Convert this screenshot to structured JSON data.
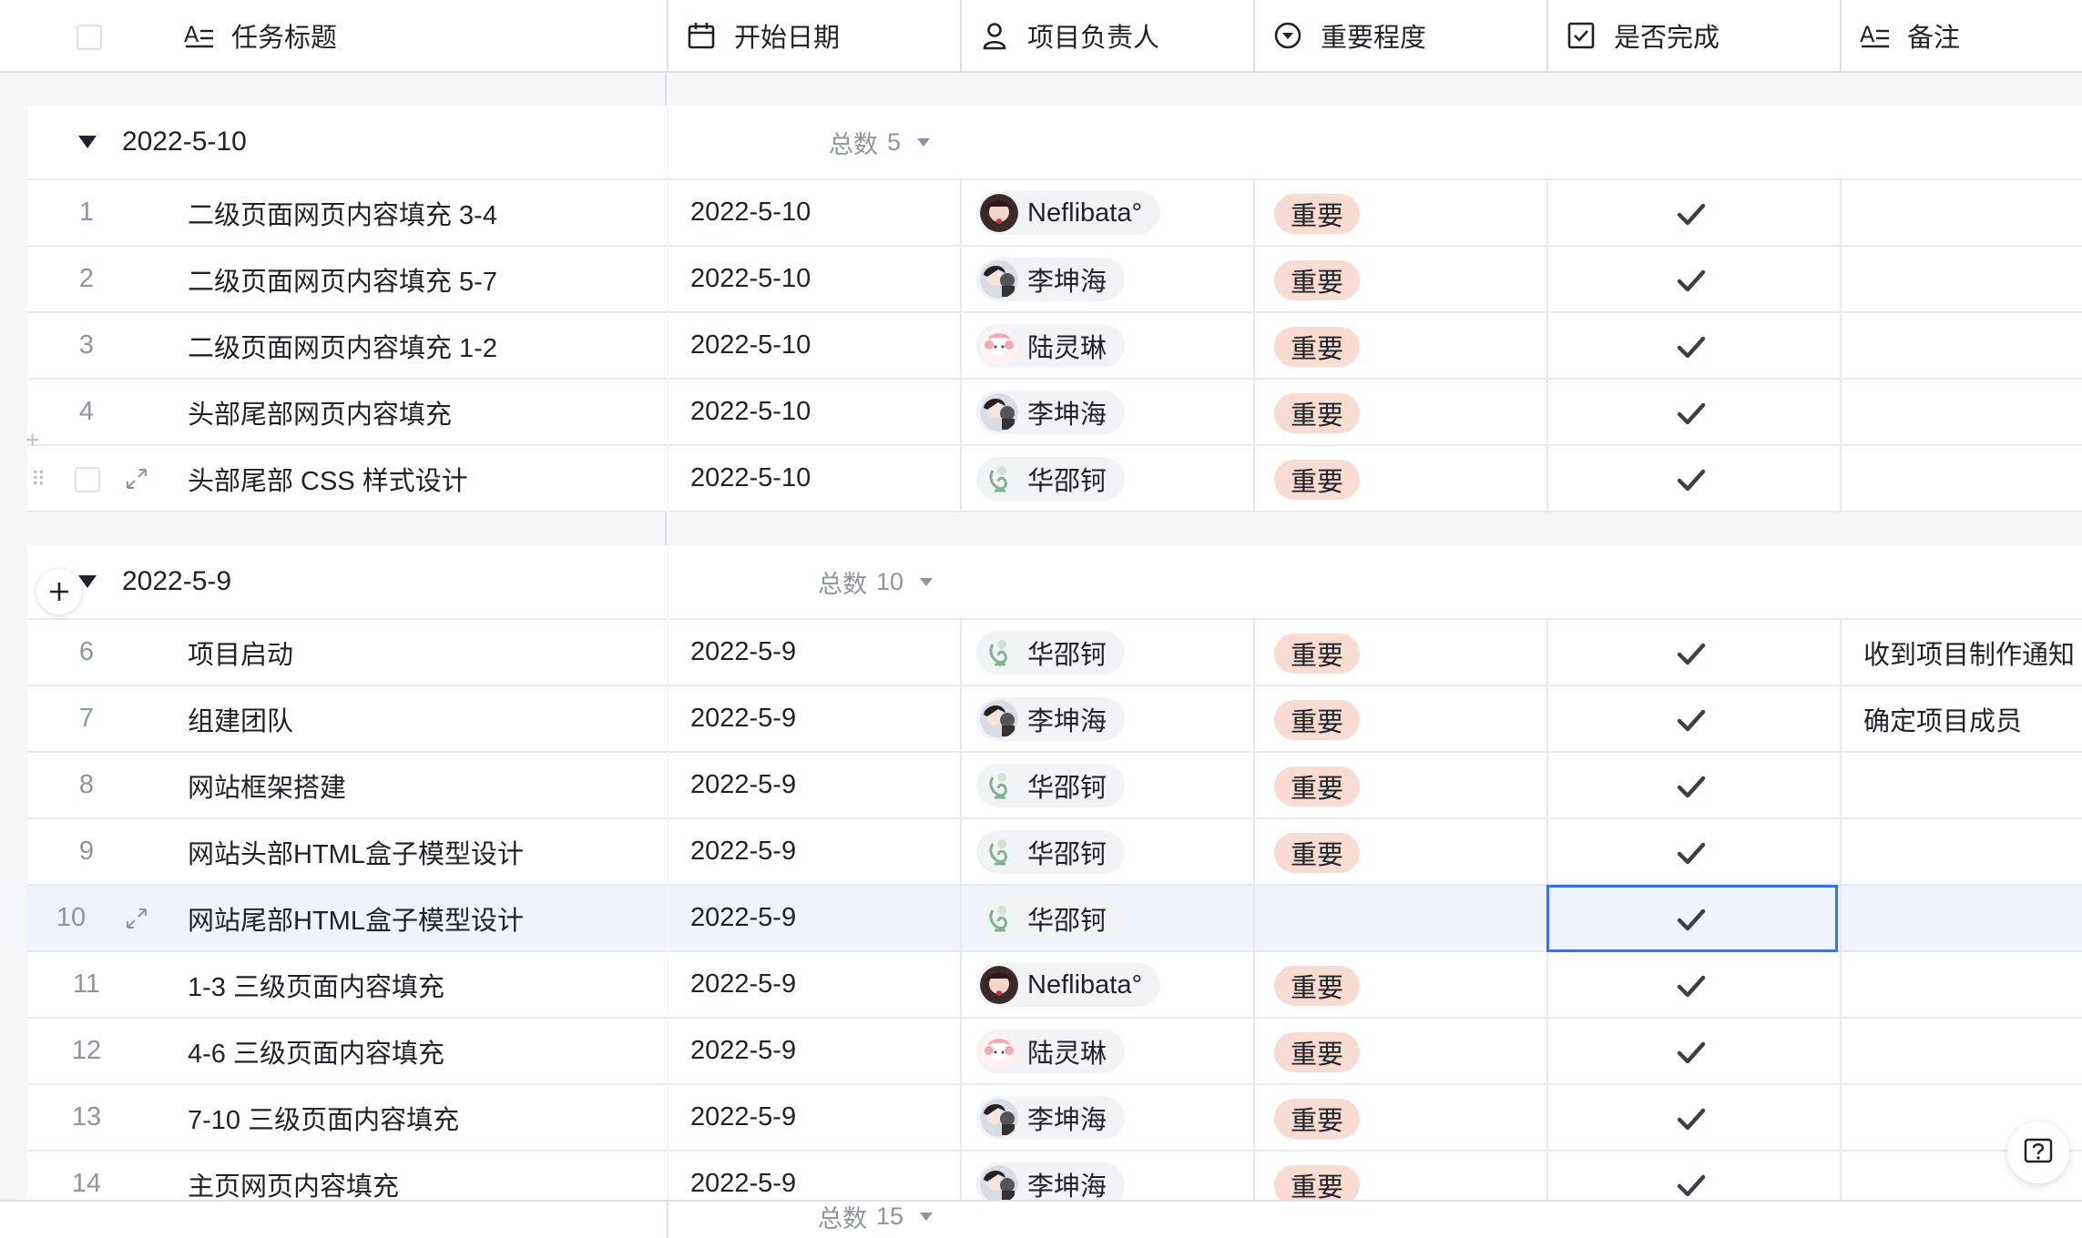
{
  "columns": [
    {
      "label": "任务标题",
      "icon": "text-icon"
    },
    {
      "label": "开始日期",
      "icon": "calendar-icon"
    },
    {
      "label": "项目负责人",
      "icon": "person-icon"
    },
    {
      "label": "重要程度",
      "icon": "single-select-icon"
    },
    {
      "label": "是否完成",
      "icon": "checkbox-icon"
    },
    {
      "label": "备注",
      "icon": "text-icon"
    }
  ],
  "groups": [
    {
      "label": "2022-5-10",
      "count_text": "总数",
      "count": "5",
      "rows": [
        {
          "num": "1",
          "title": "二级页面网页内容填充 3-4",
          "date": "2022-5-10",
          "owner": "Neflibata°",
          "avatar": "dark",
          "tag": "重要",
          "done": true,
          "note": ""
        },
        {
          "num": "2",
          "title": "二级页面网页内容填充 5-7",
          "date": "2022-5-10",
          "owner": "李坤海",
          "avatar": "boy",
          "tag": "重要",
          "done": true,
          "note": ""
        },
        {
          "num": "3",
          "title": "二级页面网页内容填充 1-2",
          "date": "2022-5-10",
          "owner": "陆灵琳",
          "avatar": "pink",
          "tag": "重要",
          "done": true,
          "note": ""
        },
        {
          "num": "4",
          "title": "头部尾部网页内容填充",
          "date": "2022-5-10",
          "owner": "李坤海",
          "avatar": "boy",
          "tag": "重要",
          "done": true,
          "note": ""
        },
        {
          "num": "",
          "title": "头部尾部 CSS 样式设计",
          "date": "2022-5-10",
          "owner": "华邵钶",
          "avatar": "green",
          "tag": "重要",
          "done": true,
          "note": ""
        }
      ]
    },
    {
      "label": "2022-5-9",
      "count_text": "总数",
      "count": "10",
      "rows": [
        {
          "num": "6",
          "title": "项目启动",
          "date": "2022-5-9",
          "owner": "华邵钶",
          "avatar": "green",
          "tag": "重要",
          "done": true,
          "note": "收到项目制作通知"
        },
        {
          "num": "7",
          "title": "组建团队",
          "date": "2022-5-9",
          "owner": "李坤海",
          "avatar": "boy",
          "tag": "重要",
          "done": true,
          "note": "确定项目成员"
        },
        {
          "num": "8",
          "title": "网站框架搭建",
          "date": "2022-5-9",
          "owner": "华邵钶",
          "avatar": "green",
          "tag": "重要",
          "done": true,
          "note": ""
        },
        {
          "num": "9",
          "title": "网站头部HTML盒子模型设计",
          "date": "2022-5-9",
          "owner": "华邵钶",
          "avatar": "green",
          "tag": "重要",
          "done": true,
          "note": ""
        },
        {
          "num": "10",
          "title": "网站尾部HTML盒子模型设计",
          "date": "2022-5-9",
          "owner": "华邵钶",
          "avatar": "green",
          "tag": "",
          "done": true,
          "note": ""
        },
        {
          "num": "11",
          "title": "1-3 三级页面内容填充",
          "date": "2022-5-9",
          "owner": "Neflibata°",
          "avatar": "dark",
          "tag": "重要",
          "done": true,
          "note": ""
        },
        {
          "num": "12",
          "title": "4-6 三级页面内容填充",
          "date": "2022-5-9",
          "owner": "陆灵琳",
          "avatar": "pink",
          "tag": "重要",
          "done": true,
          "note": ""
        },
        {
          "num": "13",
          "title": "7-10 三级页面内容填充",
          "date": "2022-5-9",
          "owner": "李坤海",
          "avatar": "boy",
          "tag": "重要",
          "done": true,
          "note": ""
        },
        {
          "num": "14",
          "title": "主页网页内容填充",
          "date": "2022-5-9",
          "owner": "李坤海",
          "avatar": "boy",
          "tag": "重要",
          "done": true,
          "note": ""
        }
      ]
    }
  ],
  "footer": {
    "count_text": "总数",
    "count": "15"
  },
  "colors": {
    "accent": "#3370ff",
    "tag_bg": "#f8dcd1",
    "selected_row": "#eef3fd"
  }
}
